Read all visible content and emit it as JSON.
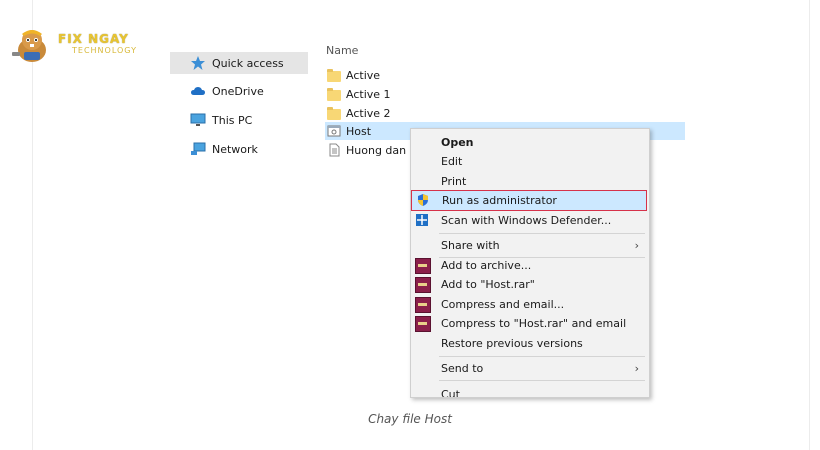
{
  "logo": {
    "text": "FIX NGAY",
    "subtext": "TECHNOLOGY"
  },
  "nav": {
    "items": [
      {
        "label": "Quick access",
        "icon": "star-icon"
      },
      {
        "label": "OneDrive",
        "icon": "cloud-icon"
      },
      {
        "label": "This PC",
        "icon": "monitor-icon"
      },
      {
        "label": "Network",
        "icon": "network-icon"
      }
    ]
  },
  "file_list": {
    "column_header": "Name",
    "files": [
      {
        "name": "Active",
        "type": "folder"
      },
      {
        "name": "Active 1",
        "type": "folder"
      },
      {
        "name": "Active 2",
        "type": "folder"
      },
      {
        "name": "Host",
        "type": "application",
        "selected": true
      },
      {
        "name": "Huong dan",
        "type": "document"
      }
    ]
  },
  "context_menu": {
    "items": [
      {
        "label": "Open",
        "bold": true
      },
      {
        "label": "Edit"
      },
      {
        "label": "Print"
      },
      {
        "label": "Run as administrator",
        "icon": "shield-icon",
        "highlighted": true
      },
      {
        "label": "Scan with Windows Defender...",
        "icon": "defender-icon"
      },
      {
        "label": "Share with",
        "submenu": true
      },
      {
        "label": "Add to archive...",
        "icon": "winrar-icon"
      },
      {
        "label": "Add to \"Host.rar\"",
        "icon": "winrar-icon"
      },
      {
        "label": "Compress and email...",
        "icon": "winrar-icon"
      },
      {
        "label": "Compress to \"Host.rar\" and email",
        "icon": "winrar-icon"
      },
      {
        "label": "Restore previous versions"
      },
      {
        "label": "Send to",
        "submenu": true
      },
      {
        "label": "Cut"
      }
    ],
    "submenu_arrow": "›"
  },
  "caption": "Chay file Host",
  "colors": {
    "selection": "#cce8ff",
    "highlight_border": "#d6324a",
    "menu_bg": "#f2f2f2"
  }
}
